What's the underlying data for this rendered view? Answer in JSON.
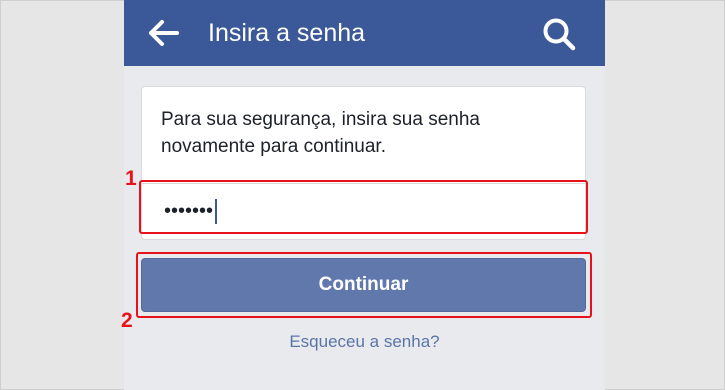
{
  "header": {
    "title": "Insira a senha",
    "back_icon": "arrow-left-icon",
    "search_icon": "search-icon",
    "background_color": "#3b5998"
  },
  "form": {
    "instruction": "Para sua segurança, insira sua senha novamente para continuar.",
    "password_value": "•••••••",
    "continue_label": "Continuar",
    "continue_color": "#6178ad",
    "forgot_link": "Esqueceu a senha?"
  },
  "annotations": {
    "step_1": "1",
    "step_2": "2",
    "color": "#e8121a"
  }
}
